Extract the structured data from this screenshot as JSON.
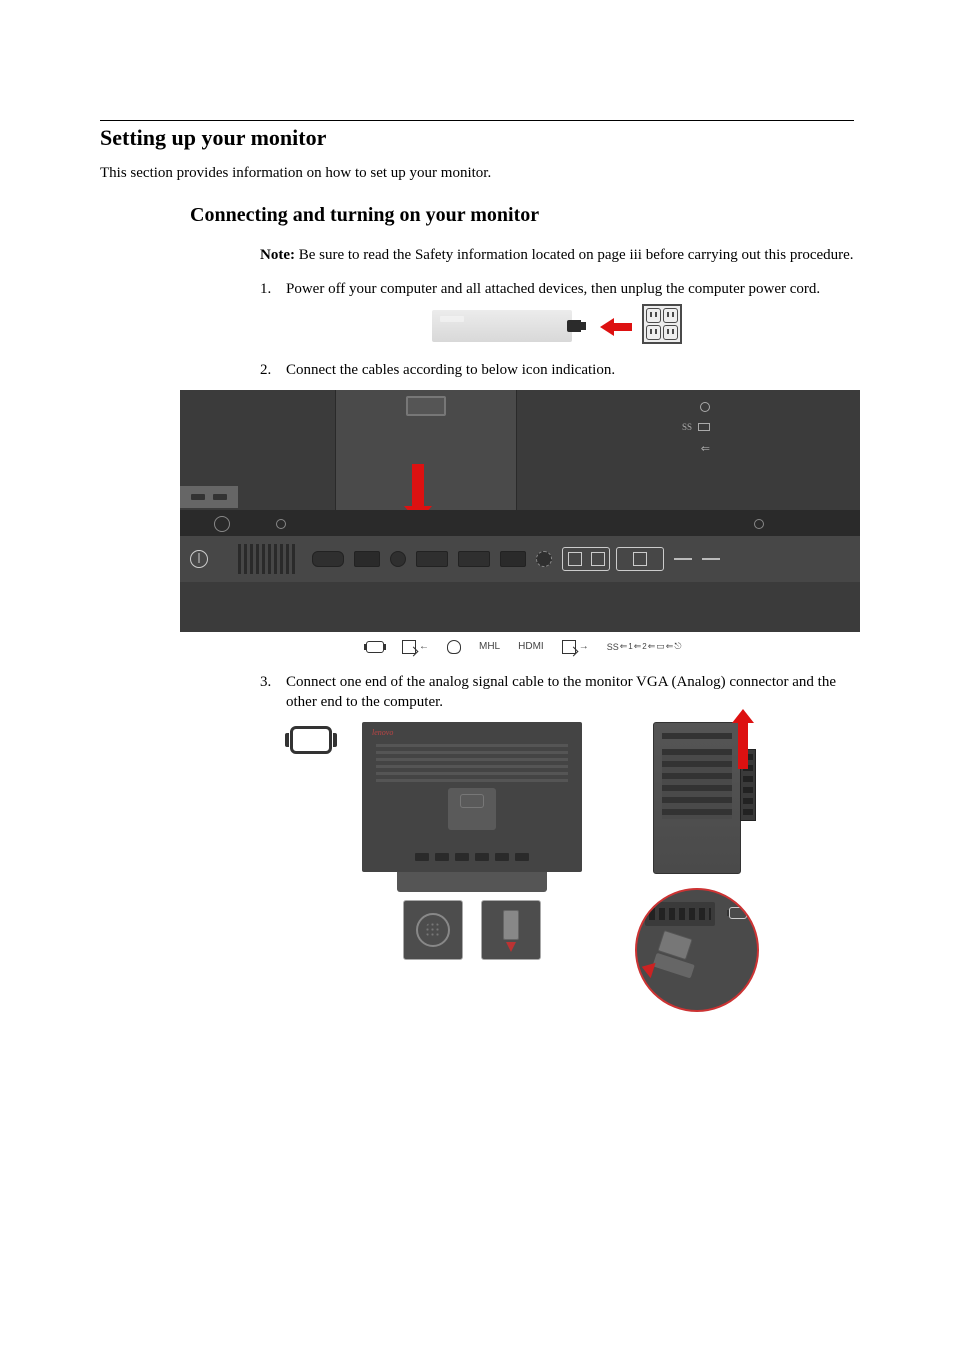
{
  "section_title": "Setting up your monitor",
  "intro": "This section provides information on how to set up your monitor.",
  "subsection_title": "Connecting and turning on your monitor",
  "note": {
    "label": "Note:",
    "text": " Be sure to read the Safety information located on page iii before carrying out this procedure."
  },
  "steps": [
    {
      "num": "1.",
      "text": "Power off your computer and all attached devices, then unplug the computer power cord."
    },
    {
      "num": "2.",
      "text": "Connect the cables according to below icon indication."
    },
    {
      "num": "3.",
      "text": "Connect one end of the analog signal cable to the monitor VGA (Analog) connector and the other end to the computer."
    }
  ],
  "port_labels": {
    "vga": " ",
    "dp_in": "D",
    "headphone": " ",
    "mhl": "MHL",
    "hdmi": "HDMI",
    "dp_out": "D",
    "usb": "SS"
  },
  "side_labels": {
    "headphone": " ",
    "ss": "SS",
    "usb": " "
  },
  "fig3_brand": "lenovo"
}
